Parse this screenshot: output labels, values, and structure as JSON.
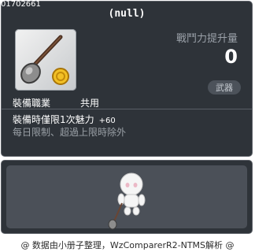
{
  "item": {
    "id": "01702661",
    "name": "(null)",
    "icon": "spoon-and-coin-icon",
    "stat_label": "戰鬥力提升量",
    "stat_value": "0",
    "category": "武器",
    "job_label": "裝備職業",
    "job_value": "共用",
    "effect_text": "裝備時僅限1次魅力",
    "effect_bonus": "+60",
    "limit_text": "每日限制、超過上限時除外"
  },
  "preview": {
    "character": "character-preview-icon"
  },
  "footer": {
    "text": "@ 数据由小册子整理，WzComparerR2-NTMS解析 @"
  },
  "colors": {
    "panel_bg": "#2e3339",
    "panel_border": "#5d6168",
    "inner_bg": "#4b5058",
    "muted_text": "#9ba1a9"
  }
}
